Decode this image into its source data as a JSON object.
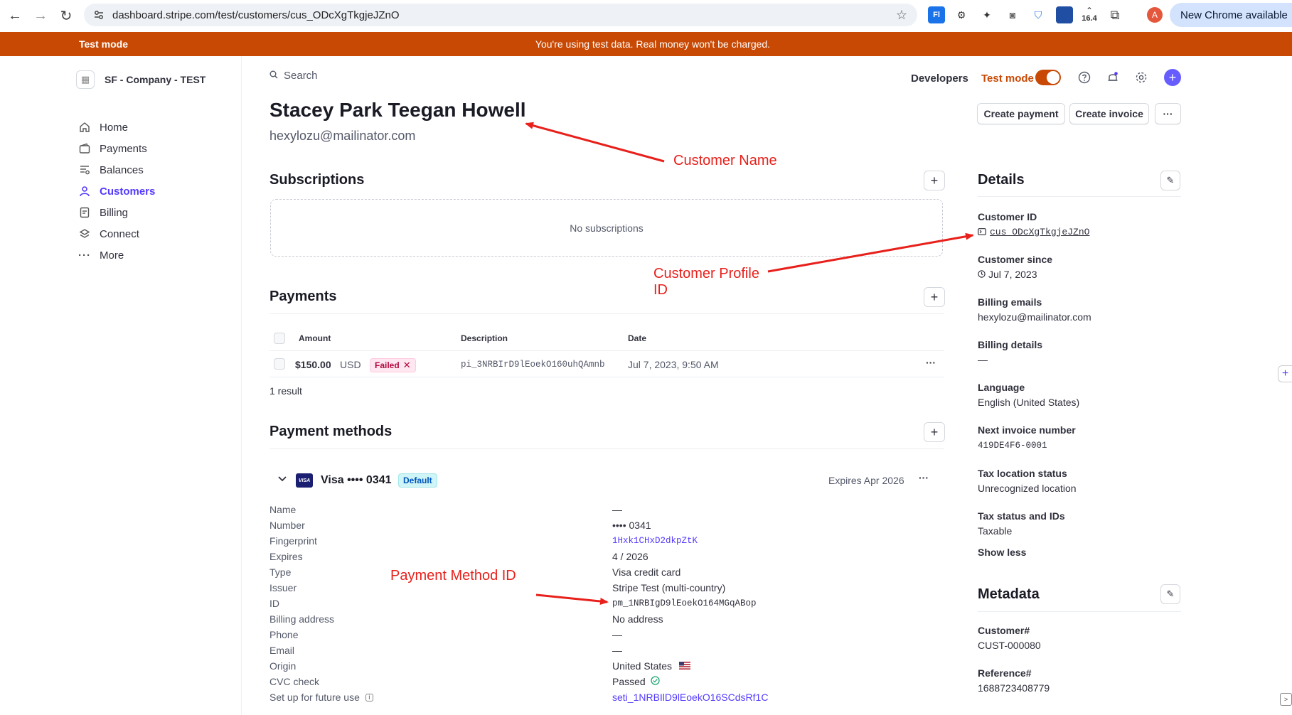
{
  "browser": {
    "url": "dashboard.stripe.com/test/customers/cus_ODcXgTkgjeJZnO",
    "ext_badge": "16.4",
    "profile_initial": "A",
    "update_label": "New Chrome available"
  },
  "banner": {
    "left": "Test mode",
    "message": "You're using test data. Real money won't be charged."
  },
  "sidebar": {
    "account": "SF - Company - TEST",
    "items": [
      {
        "label": "Home",
        "icon": "home-icon"
      },
      {
        "label": "Payments",
        "icon": "wallet-icon"
      },
      {
        "label": "Balances",
        "icon": "balances-icon"
      },
      {
        "label": "Customers",
        "icon": "user-icon"
      },
      {
        "label": "Billing",
        "icon": "receipt-icon"
      },
      {
        "label": "Connect",
        "icon": "layers-icon"
      },
      {
        "label": "More",
        "icon": "dots-icon"
      }
    ]
  },
  "topbar": {
    "search_placeholder": "Search",
    "developers": "Developers",
    "test_mode": "Test mode"
  },
  "customer": {
    "name": "Stacey Park Teegan Howell",
    "email": "hexylozu@mailinator.com"
  },
  "actions": {
    "create_payment": "Create payment",
    "create_invoice": "Create invoice",
    "more": "···"
  },
  "subscriptions": {
    "title": "Subscriptions",
    "empty": "No subscriptions"
  },
  "payments": {
    "title": "Payments",
    "columns": [
      "Amount",
      "Description",
      "Date"
    ],
    "rows": [
      {
        "amount": "$150.00",
        "currency": "USD",
        "status": "Failed",
        "description": "pi_3NRBIrD9lEoekO160uhQAmnb",
        "date": "Jul 7, 2023, 9:50 AM"
      }
    ],
    "result_count": "1 result"
  },
  "payment_methods": {
    "title": "Payment methods",
    "card_title": "Visa •••• 0341",
    "default_badge": "Default",
    "expires": "Expires Apr 2026",
    "brand_logo": "VISA",
    "fields": [
      {
        "key": "Name",
        "value": "—"
      },
      {
        "key": "Number",
        "value": "•••• 0341"
      },
      {
        "key": "Fingerprint",
        "value": "1Hxk1CHxD2dkpZtK"
      },
      {
        "key": "Expires",
        "value": "4 / 2026"
      },
      {
        "key": "Type",
        "value": "Visa credit card"
      },
      {
        "key": "Issuer",
        "value": "Stripe Test (multi-country)"
      },
      {
        "key": "ID",
        "value": "pm_1NRBIgD9lEoekO164MGqABop"
      },
      {
        "key": "Billing address",
        "value": "No address"
      },
      {
        "key": "Phone",
        "value": "—"
      },
      {
        "key": "Email",
        "value": "—"
      },
      {
        "key": "Origin",
        "value": "United States"
      },
      {
        "key": "CVC check",
        "value": "Passed"
      },
      {
        "key": "Set up for future use",
        "value": "seti_1NRBIlD9lEoekO16SCdsRf1C"
      }
    ]
  },
  "details": {
    "title": "Details",
    "customer_id_label": "Customer ID",
    "customer_id": "cus_ODcXgTkgjeJZnO",
    "since_label": "Customer since",
    "since": "Jul 7, 2023",
    "billing_emails_label": "Billing emails",
    "billing_emails": "hexylozu@mailinator.com",
    "billing_details_label": "Billing details",
    "billing_details": "—",
    "language_label": "Language",
    "language": "English (United States)",
    "next_invoice_label": "Next invoice number",
    "next_invoice": "419DE4F6-0001",
    "tax_location_label": "Tax location status",
    "tax_location": "Unrecognized location",
    "tax_status_label": "Tax status and IDs",
    "tax_status": "Taxable",
    "show_less": "Show less"
  },
  "metadata": {
    "title": "Metadata",
    "customer_no_label": "Customer#",
    "customer_no": "CUST-000080",
    "reference_label": "Reference#",
    "reference": "1688723408779"
  },
  "annotations": {
    "customer_name": "Customer Name",
    "profile_id": "Customer Profile",
    "profile_id_2": "ID",
    "payment_method_id": "Payment Method ID",
    "color": "#e8201b"
  },
  "colors": {
    "test_mode": "#c84904",
    "accent": "#533afd",
    "failed": "#b3093c"
  }
}
